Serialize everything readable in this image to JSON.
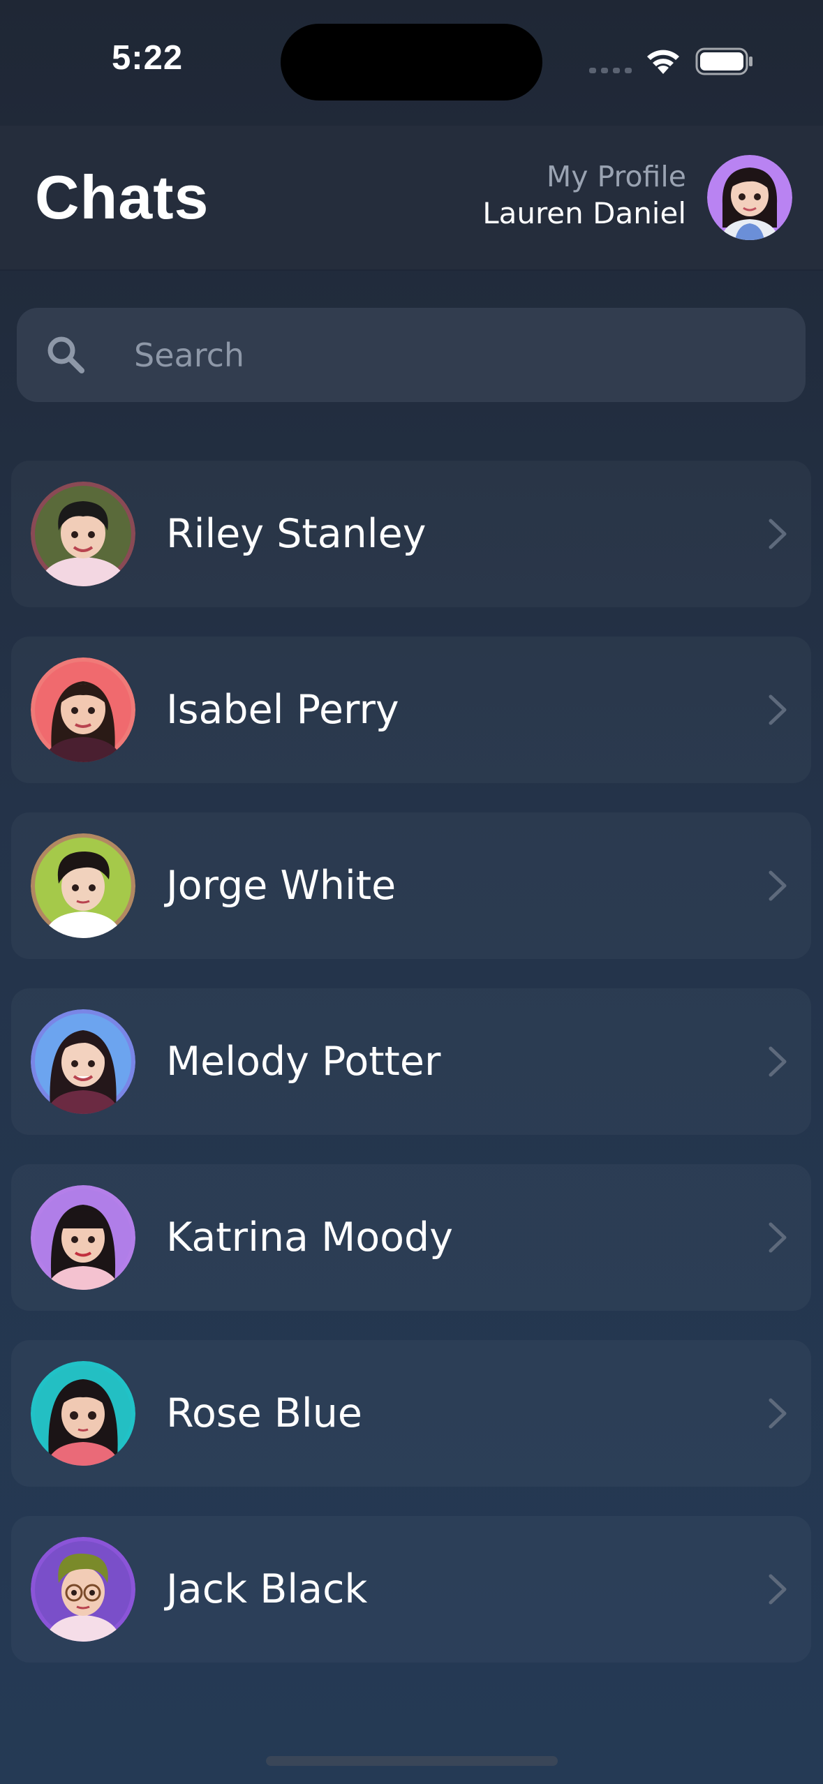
{
  "status_bar": {
    "time": "5:22"
  },
  "header": {
    "title": "Chats",
    "profile_caption": "My Profile",
    "profile_name": "Lauren Daniel",
    "profile_avatar_color": "#b983f2"
  },
  "search": {
    "placeholder": "Search",
    "value": ""
  },
  "chats": [
    {
      "name": "Riley Stanley",
      "avatar_bg": "#5a6a3a",
      "avatar_ring": "#8a4a55",
      "hair": "#1a1a1a",
      "skin": "#f1cdb8",
      "shirt": "#f3d7e2"
    },
    {
      "name": "Isabel Perry",
      "avatar_bg": "#f06a6e",
      "avatar_ring": "#f07a78",
      "hair": "#2a1a16",
      "skin": "#f2c8b1",
      "shirt": "#4a1f30"
    },
    {
      "name": "Jorge White",
      "avatar_bg": "#a5c94a",
      "avatar_ring": "#b28862",
      "hair": "#1c1514",
      "skin": "#f1d2bd",
      "shirt": "#ffffff"
    },
    {
      "name": "Melody Potter",
      "avatar_bg": "#6ca4ef",
      "avatar_ring": "#7a86e6",
      "hair": "#24171a",
      "skin": "#f3d2bf",
      "shirt": "#6b2a42"
    },
    {
      "name": "Katrina Moody",
      "avatar_bg": "#b07ee8",
      "avatar_ring": "#b47fe9",
      "hair": "#1b1416",
      "skin": "#f1cbb6",
      "shirt": "#f4c2d0"
    },
    {
      "name": "Rose Blue",
      "avatar_bg": "#23bfc3",
      "avatar_ring": "#21c2c7",
      "hair": "#1b1416",
      "skin": "#f0c9b3",
      "shirt": "#ea6a78"
    },
    {
      "name": "Jack Black",
      "avatar_bg": "#7a4fc9",
      "avatar_ring": "#8b55d8",
      "hair": "#7a8a2a",
      "skin": "#f2ccb6",
      "shirt": "#f5dde8"
    }
  ],
  "icons": {
    "search": "search-icon",
    "chevron": "chevron-right-icon",
    "wifi": "wifi-icon",
    "battery": "battery-icon",
    "signal": "cellular-signal-icon"
  }
}
